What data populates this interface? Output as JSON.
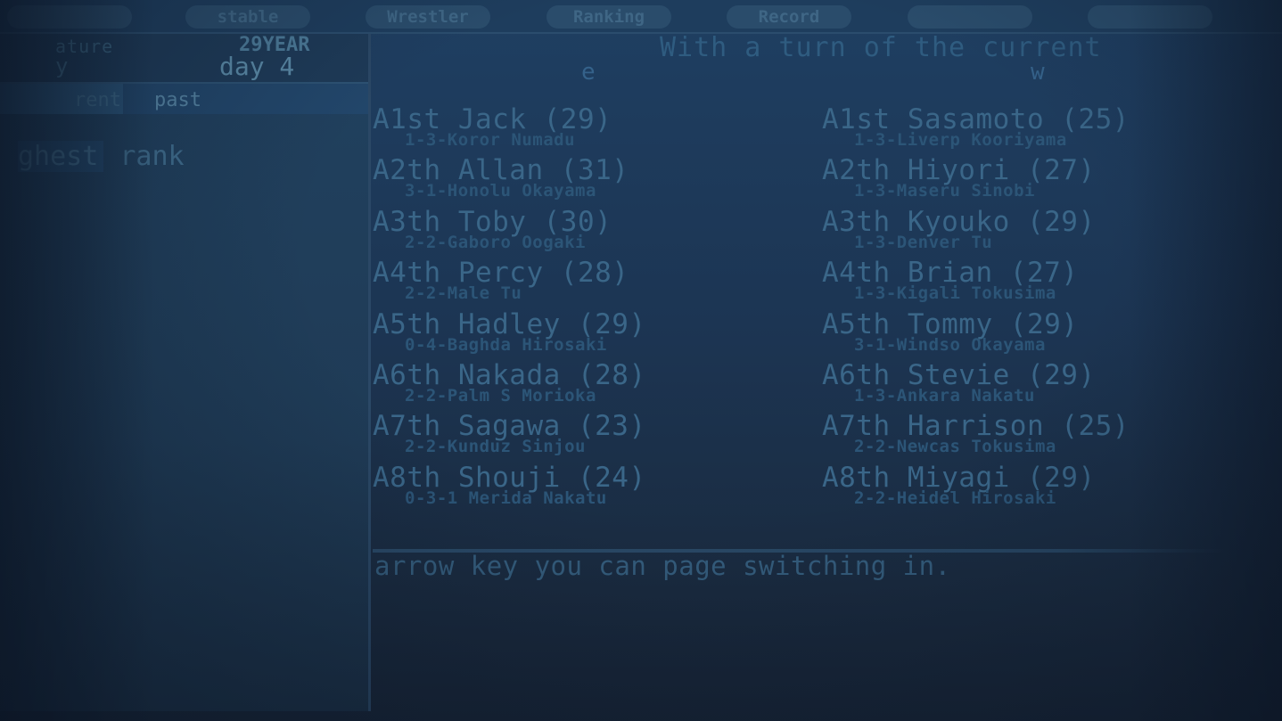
{
  "tabs": [
    {
      "label": ""
    },
    {
      "label": "stable"
    },
    {
      "label": "Wrestler"
    },
    {
      "label": "Ranking"
    },
    {
      "label": "Record"
    },
    {
      "label": ""
    },
    {
      "label": ""
    }
  ],
  "left": {
    "feature_label": "ature",
    "year_label": "29YEAR",
    "day_prefix": "y",
    "day_label": "day 4",
    "subtab_current": "rent",
    "subtab_past": "past",
    "highest_rank_prefix": "ghest",
    "highest_rank_suffix": " rank"
  },
  "main": {
    "title": "With a turn of the current",
    "east_label": "e",
    "west_label": "w",
    "hint": "arrow key you can page switching in."
  },
  "east": [
    {
      "name": "A1st Jack (29)",
      "detail": "1-3-Koror Numadu"
    },
    {
      "name": "A2th Allan (31)",
      "detail": "3-1-Honolu Okayama"
    },
    {
      "name": "A3th Toby (30)",
      "detail": "2-2-Gaboro Oogaki"
    },
    {
      "name": "A4th Percy (28)",
      "detail": "2-2-Male Tu"
    },
    {
      "name": "A5th Hadley (29)",
      "detail": "0-4-Baghda Hirosaki"
    },
    {
      "name": "A6th Nakada (28)",
      "detail": "2-2-Palm S Morioka"
    },
    {
      "name": "A7th Sagawa (23)",
      "detail": "2-2-Kunduz Sinjou"
    },
    {
      "name": "A8th Shouji (24)",
      "detail": "0-3-1 Merida Nakatu"
    }
  ],
  "west": [
    {
      "name": "A1st Sasamoto (25)",
      "detail": "1-3-Liverp Kooriyama"
    },
    {
      "name": "A2th Hiyori (27)",
      "detail": "1-3-Maseru Sinobi"
    },
    {
      "name": "A3th Kyouko (29)",
      "detail": "1-3-Denver Tu"
    },
    {
      "name": "A4th Brian (27)",
      "detail": "1-3-Kigali Tokusima"
    },
    {
      "name": "A5th Tommy (29)",
      "detail": "3-1-Windso Okayama"
    },
    {
      "name": "A6th Stevie (29)",
      "detail": "1-3-Ankara Nakatu"
    },
    {
      "name": "A7th Harrison (25)",
      "detail": "2-2-Newcas Tokusima"
    },
    {
      "name": "A8th Miyagi (29)",
      "detail": "2-2-Heidel Hirosaki"
    }
  ]
}
